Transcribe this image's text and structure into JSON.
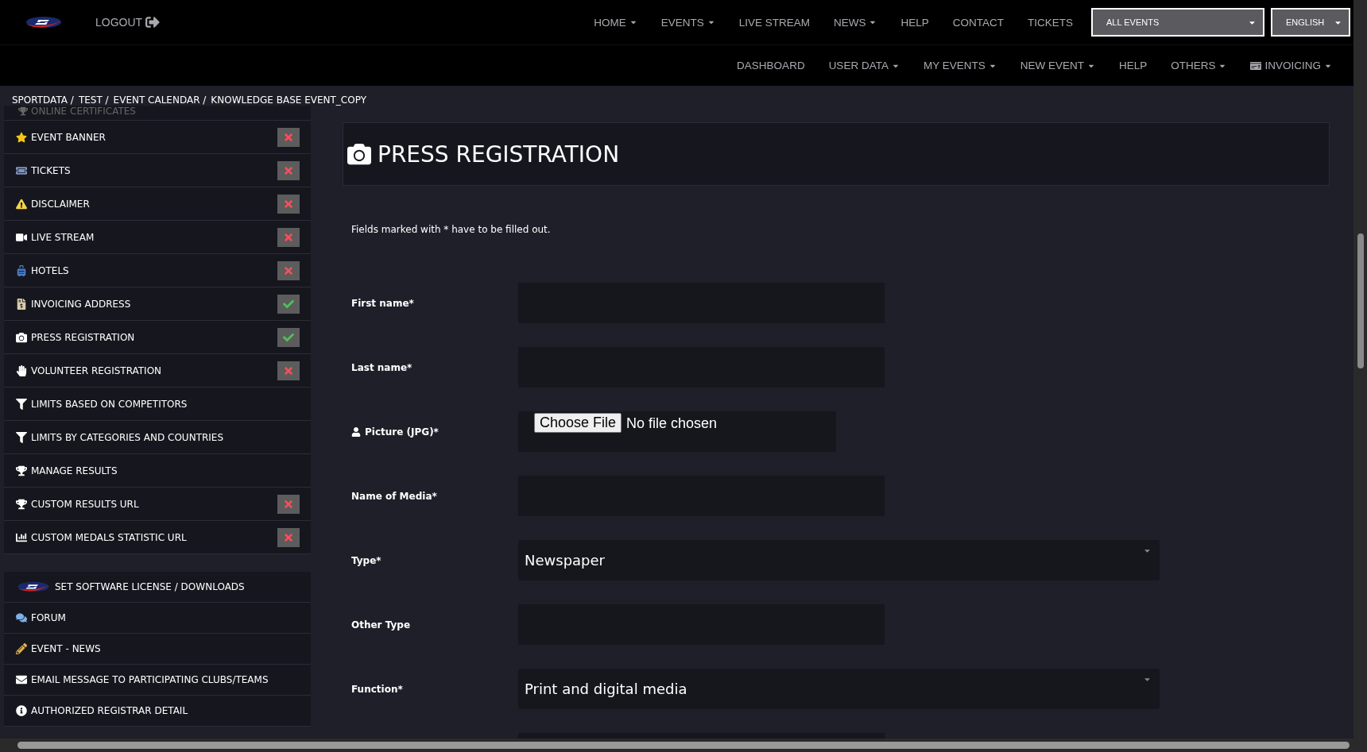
{
  "header": {
    "logout": "LOGOUT",
    "nav": [
      {
        "label": "HOME",
        "dropdown": true
      },
      {
        "label": "EVENTS",
        "dropdown": true
      },
      {
        "label": "LIVE STREAM",
        "dropdown": false
      },
      {
        "label": "NEWS",
        "dropdown": true
      },
      {
        "label": "HELP",
        "dropdown": false
      },
      {
        "label": "CONTACT",
        "dropdown": false
      },
      {
        "label": "TICKETS",
        "dropdown": false
      }
    ],
    "event_select": "ALL EVENTS",
    "language_select": "ENGLISH"
  },
  "subnav": [
    {
      "label": "DASHBOARD",
      "dropdown": false
    },
    {
      "label": "USER DATA",
      "dropdown": true
    },
    {
      "label": "MY EVENTS",
      "dropdown": true
    },
    {
      "label": "NEW EVENT",
      "dropdown": true
    },
    {
      "label": "HELP",
      "dropdown": false
    },
    {
      "label": "OTHERS",
      "dropdown": true
    },
    {
      "label": "INVOICING",
      "dropdown": true
    }
  ],
  "breadcrumb": [
    "SPORTDATA /",
    "TEST /",
    "EVENT CALENDAR /",
    "KNOWLEDGE BASE EVENT_COPY"
  ],
  "sidebar": {
    "partial_item": "ONLINE CERTIFICATES",
    "groups": [
      {
        "items": [
          {
            "label": "EVENT BANNER",
            "kind": "status",
            "complete": false
          },
          {
            "label": "TICKETS",
            "kind": "status",
            "complete": false
          },
          {
            "label": "DISCLAIMER",
            "kind": "status",
            "complete": false
          },
          {
            "label": "LIVE STREAM",
            "kind": "status",
            "complete": false
          },
          {
            "label": "HOTELS",
            "kind": "status",
            "complete": false
          },
          {
            "label": "INVOICING ADDRESS",
            "kind": "status",
            "complete": true
          },
          {
            "label": "PRESS REGISTRATION",
            "kind": "status",
            "complete": true
          },
          {
            "label": "VOLUNTEER REGISTRATION",
            "kind": "status",
            "complete": false
          },
          {
            "label": "LIMITS BASED ON COMPETITORS",
            "kind": "plain"
          },
          {
            "label": "LIMITS BY CATEGORIES AND COUNTRIES",
            "kind": "plain"
          },
          {
            "label": "MANAGE RESULTS",
            "kind": "plain"
          },
          {
            "label": "CUSTOM RESULTS URL",
            "kind": "status",
            "complete": false
          },
          {
            "label": "CUSTOM MEDALS STATISTIC URL",
            "kind": "status",
            "complete": false
          }
        ]
      },
      {
        "items": [
          {
            "label": "SET SOFTWARE LICENSE / DOWNLOADS",
            "kind": "plain"
          },
          {
            "label": "FORUM",
            "kind": "plain"
          },
          {
            "label": "EVENT - NEWS",
            "kind": "plain"
          },
          {
            "label": "EMAIL MESSAGE TO PARTICIPATING CLUBS/TEAMS",
            "kind": "plain"
          },
          {
            "label": "AUTHORIZED REGISTRAR DETAIL",
            "kind": "plain"
          }
        ]
      }
    ]
  },
  "form": {
    "title": "PRESS REGISTRATION",
    "note": "Fields marked with * have to be filled out.",
    "fields": [
      {
        "kind": "text",
        "label": "First name*"
      },
      {
        "kind": "text",
        "label": "Last name*"
      },
      {
        "kind": "file",
        "label": "Picture (JPG)*",
        "button": "Choose File",
        "status": "No file chosen"
      },
      {
        "kind": "text",
        "label": "Name of Media*"
      },
      {
        "kind": "select",
        "label": "Type*",
        "value": "Newspaper"
      },
      {
        "kind": "text",
        "label": "Other Type"
      },
      {
        "kind": "select",
        "label": "Function*",
        "value": "Print and digital media"
      },
      {
        "kind": "text"
      }
    ]
  }
}
